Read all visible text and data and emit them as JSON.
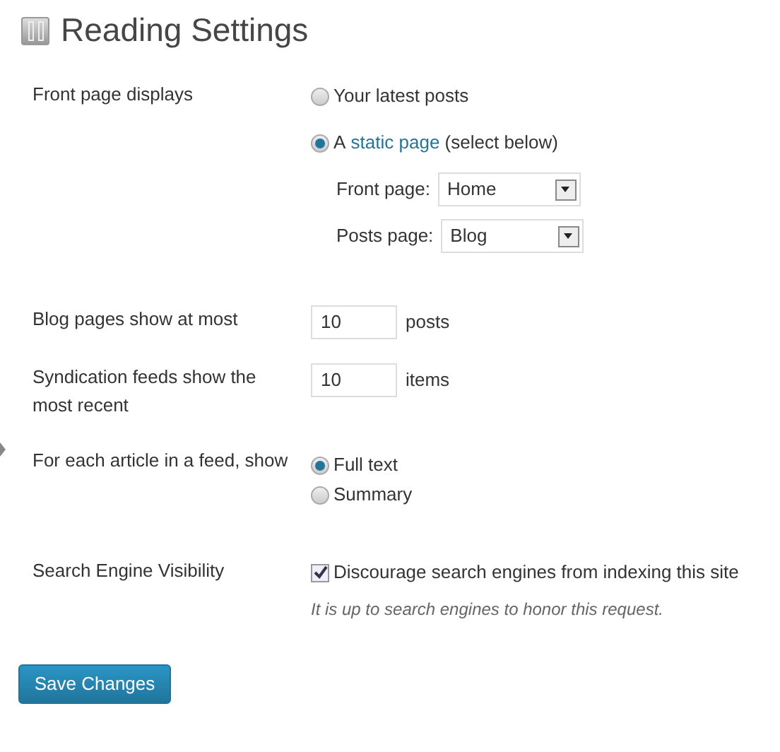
{
  "title": "Reading Settings",
  "front_page_displays": {
    "label": "Front page displays",
    "options": [
      {
        "kind": "plain",
        "text": "Your latest posts",
        "selected": false
      },
      {
        "kind": "link",
        "prefix": "A",
        "link": "static page",
        "suffix": "(select below)",
        "selected": true
      }
    ],
    "selects": [
      {
        "label": "Front page:",
        "value": "Home"
      },
      {
        "label": "Posts page:",
        "value": "Blog"
      }
    ]
  },
  "blog_pages": {
    "label": "Blog pages show at most",
    "value": "10",
    "unit": "posts"
  },
  "syndication": {
    "label": "Syndication feeds show the most recent",
    "value": "10",
    "unit": "items"
  },
  "feed_article": {
    "label": "For each article in a feed, show",
    "options": [
      {
        "text": "Full text",
        "selected": true
      },
      {
        "text": "Summary",
        "selected": false
      }
    ]
  },
  "search_visibility": {
    "label": "Search Engine Visibility",
    "checkbox": {
      "text": "Discourage search engines from indexing this site",
      "checked": true
    },
    "hint": "It is up to search engines to honor this request."
  },
  "save_button": "Save Changes"
}
